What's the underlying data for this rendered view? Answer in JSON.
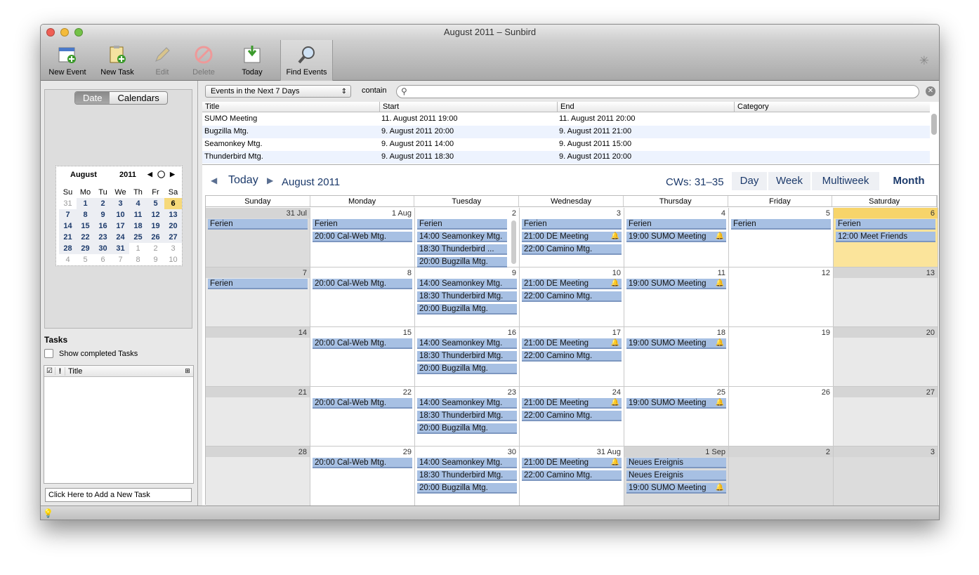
{
  "window": {
    "title": "August 2011 – Sunbird"
  },
  "toolbar": {
    "new_event": "New Event",
    "new_task": "New Task",
    "edit": "Edit",
    "delete": "Delete",
    "today": "Today",
    "find_events": "Find Events"
  },
  "sidebar": {
    "tab_date": "Date",
    "tab_calendars": "Calendars",
    "minical": {
      "month": "August",
      "year": "2011",
      "weekdays": [
        "Su",
        "Mo",
        "Tu",
        "We",
        "Th",
        "Fr",
        "Sa"
      ],
      "days": [
        [
          "31",
          "1",
          "2",
          "3",
          "4",
          "5",
          "6"
        ],
        [
          "7",
          "8",
          "9",
          "10",
          "11",
          "12",
          "13"
        ],
        [
          "14",
          "15",
          "16",
          "17",
          "18",
          "19",
          "20"
        ],
        [
          "21",
          "22",
          "23",
          "24",
          "25",
          "26",
          "27"
        ],
        [
          "28",
          "29",
          "30",
          "31",
          "1",
          "2",
          "3"
        ],
        [
          "4",
          "5",
          "6",
          "7",
          "8",
          "9",
          "10"
        ]
      ]
    },
    "tasks_heading": "Tasks",
    "show_completed": "Show completed Tasks",
    "task_col_title": "Title",
    "new_task_placeholder": "Click Here to Add a New Task"
  },
  "search": {
    "filter": "Events in the Next 7 Days",
    "contain_label": "contain",
    "query": ""
  },
  "results": {
    "columns": [
      "Title",
      "Start",
      "End",
      "Category"
    ],
    "rows": [
      [
        "SUMO Meeting",
        "11. August 2011 19:00",
        "11. August 2011 20:00",
        ""
      ],
      [
        "Bugzilla Mtg.",
        "9. August 2011 20:00",
        "9. August 2011 21:00",
        ""
      ],
      [
        "Seamonkey Mtg.",
        "9. August 2011 14:00",
        "9. August 2011 15:00",
        ""
      ],
      [
        "Thunderbird Mtg.",
        "9. August 2011 18:30",
        "9. August 2011 20:00",
        ""
      ]
    ]
  },
  "nav": {
    "today": "Today",
    "title": "August 2011",
    "cws": "CWs: 31–35",
    "views": [
      "Day",
      "Week",
      "Multiweek",
      "Month"
    ],
    "selected_view": "Month"
  },
  "month": {
    "day_headers": [
      "Sunday",
      "Monday",
      "Tuesday",
      "Wednesday",
      "Thursday",
      "Friday",
      "Saturday"
    ],
    "weeks": [
      [
        {
          "d": "31 Jul",
          "kind": "oth",
          "ev": [
            {
              "t": "Ferien"
            }
          ]
        },
        {
          "d": "1 Aug",
          "ev": [
            {
              "t": "Ferien"
            },
            {
              "t": "20:00 Cal-Web Mtg."
            }
          ]
        },
        {
          "d": "2",
          "ev": [
            {
              "t": "Ferien"
            },
            {
              "t": "14:00 Seamonkey Mtg."
            },
            {
              "t": "18:30 Thunderbird ..."
            },
            {
              "t": "20:00 Bugzilla Mtg."
            }
          ]
        },
        {
          "d": "3",
          "ev": [
            {
              "t": "Ferien"
            },
            {
              "t": "21:00 DE Meeting",
              "a": 1
            },
            {
              "t": "22:00 Camino Mtg."
            }
          ]
        },
        {
          "d": "4",
          "ev": [
            {
              "t": "Ferien"
            },
            {
              "t": "19:00 SUMO Meeting",
              "a": 1
            }
          ]
        },
        {
          "d": "5",
          "ev": [
            {
              "t": "Ferien"
            }
          ]
        },
        {
          "d": "6",
          "kind": "tod",
          "ev": [
            {
              "t": "Ferien"
            },
            {
              "t": "12:00 Meet Friends"
            }
          ]
        }
      ],
      [
        {
          "d": "7",
          "kind": "we",
          "ev": [
            {
              "t": "Ferien"
            }
          ]
        },
        {
          "d": "8",
          "ev": [
            {
              "t": "20:00 Cal-Web Mtg."
            }
          ]
        },
        {
          "d": "9",
          "ev": [
            {
              "t": "14:00 Seamonkey Mtg."
            },
            {
              "t": "18:30 Thunderbird Mtg."
            },
            {
              "t": "20:00 Bugzilla Mtg."
            }
          ]
        },
        {
          "d": "10",
          "ev": [
            {
              "t": "21:00 DE Meeting",
              "a": 1
            },
            {
              "t": "22:00 Camino Mtg."
            }
          ]
        },
        {
          "d": "11",
          "ev": [
            {
              "t": "19:00 SUMO Meeting",
              "a": 1
            }
          ]
        },
        {
          "d": "12",
          "ev": []
        },
        {
          "d": "13",
          "kind": "we",
          "ev": []
        }
      ],
      [
        {
          "d": "14",
          "kind": "we",
          "ev": []
        },
        {
          "d": "15",
          "ev": [
            {
              "t": "20:00 Cal-Web Mtg."
            }
          ]
        },
        {
          "d": "16",
          "ev": [
            {
              "t": "14:00 Seamonkey Mtg."
            },
            {
              "t": "18:30 Thunderbird Mtg."
            },
            {
              "t": "20:00 Bugzilla Mtg."
            }
          ]
        },
        {
          "d": "17",
          "ev": [
            {
              "t": "21:00 DE Meeting",
              "a": 1
            },
            {
              "t": "22:00 Camino Mtg."
            }
          ]
        },
        {
          "d": "18",
          "ev": [
            {
              "t": "19:00 SUMO Meeting",
              "a": 1
            }
          ]
        },
        {
          "d": "19",
          "ev": []
        },
        {
          "d": "20",
          "kind": "we",
          "ev": []
        }
      ],
      [
        {
          "d": "21",
          "kind": "we",
          "ev": []
        },
        {
          "d": "22",
          "ev": [
            {
              "t": "20:00 Cal-Web Mtg."
            }
          ]
        },
        {
          "d": "23",
          "ev": [
            {
              "t": "14:00 Seamonkey Mtg."
            },
            {
              "t": "18:30 Thunderbird Mtg."
            },
            {
              "t": "20:00 Bugzilla Mtg."
            }
          ]
        },
        {
          "d": "24",
          "ev": [
            {
              "t": "21:00 DE Meeting",
              "a": 1
            },
            {
              "t": "22:00 Camino Mtg."
            }
          ]
        },
        {
          "d": "25",
          "ev": [
            {
              "t": "19:00 SUMO Meeting",
              "a": 1
            }
          ]
        },
        {
          "d": "26",
          "ev": []
        },
        {
          "d": "27",
          "kind": "we",
          "ev": []
        }
      ],
      [
        {
          "d": "28",
          "kind": "we",
          "ev": []
        },
        {
          "d": "29",
          "ev": [
            {
              "t": "20:00 Cal-Web Mtg."
            }
          ]
        },
        {
          "d": "30",
          "ev": [
            {
              "t": "14:00 Seamonkey Mtg."
            },
            {
              "t": "18:30 Thunderbird Mtg."
            },
            {
              "t": "20:00 Bugzilla Mtg."
            }
          ]
        },
        {
          "d": "31 Aug",
          "ev": [
            {
              "t": "21:00 DE Meeting",
              "a": 1
            },
            {
              "t": "22:00 Camino Mtg."
            }
          ]
        },
        {
          "d": "1 Sep",
          "kind": "oth",
          "ev": [
            {
              "t": "Neues Ereignis"
            },
            {
              "t": "Neues Ereignis"
            },
            {
              "t": "19:00 SUMO Meeting",
              "a": 1
            }
          ]
        },
        {
          "d": "2",
          "kind": "oth",
          "ev": []
        },
        {
          "d": "3",
          "kind": "oth",
          "ev": []
        }
      ]
    ]
  },
  "colors": {
    "event": "#a7c0e3",
    "today": "#fbe49b",
    "accent": "#1c3a6b"
  }
}
